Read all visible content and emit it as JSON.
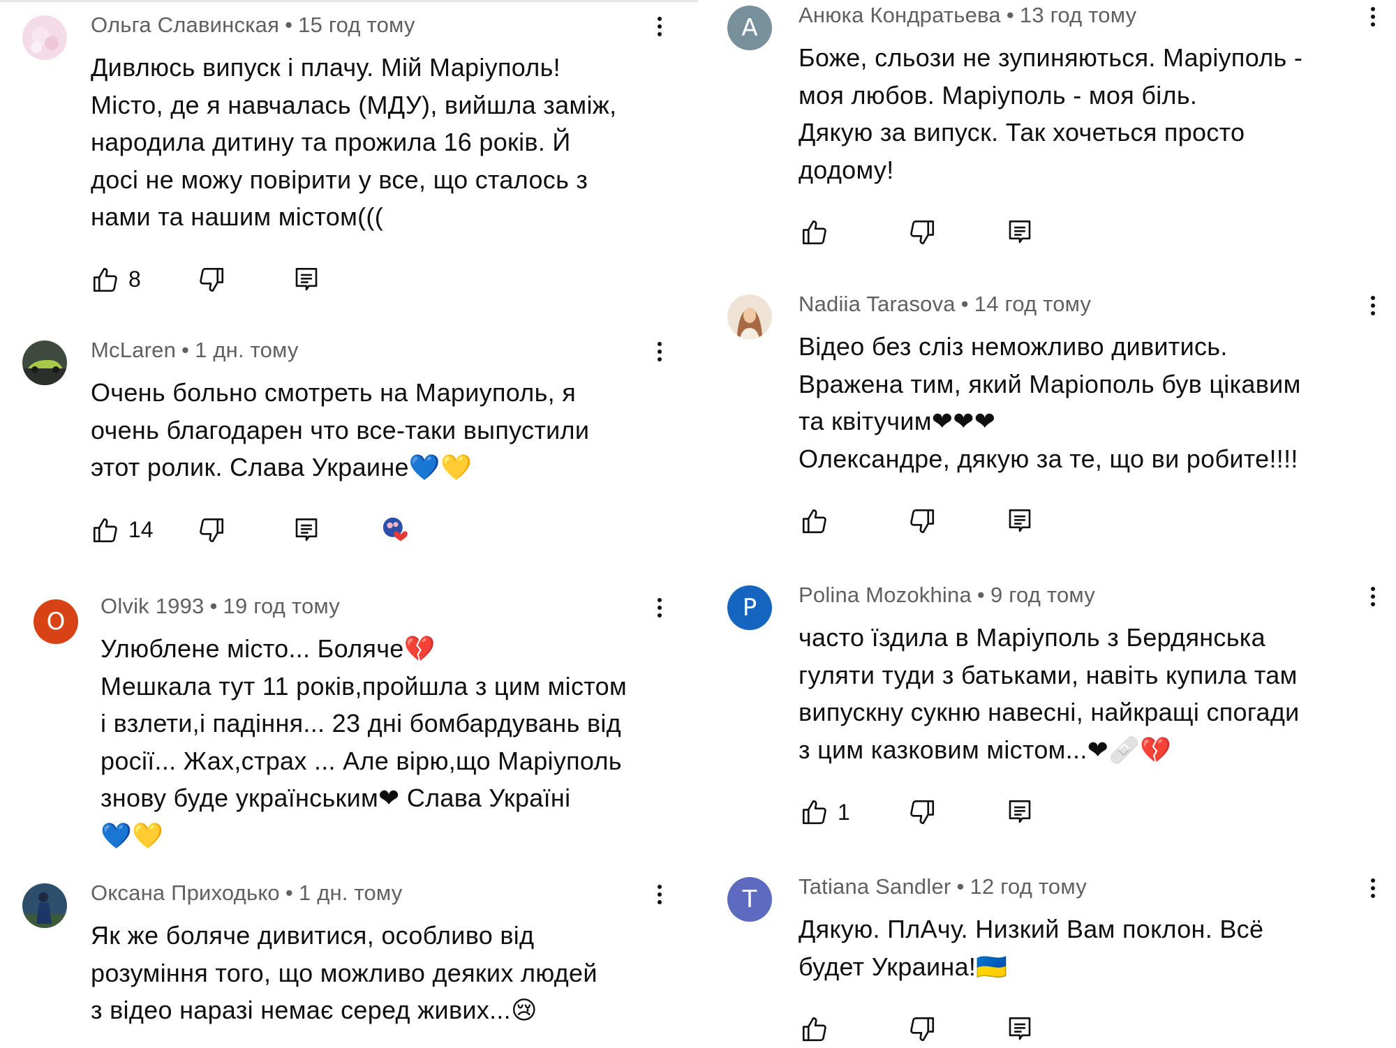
{
  "left": [
    {
      "author": "Ольга Славинская",
      "time": "15 год тому",
      "avatar": {
        "type": "image",
        "name": "flowers-photo"
      },
      "lines": [
        "Дивлюсь випуск і плачу. Мій Маріуполь!",
        "Місто, де я навчалась (МДУ), вийшла заміж,",
        "народила дитину та прожила 16 років. Й",
        "досі не можу повірити у все, що сталось з",
        "нами та нашим містом((("
      ],
      "likes": "8"
    },
    {
      "author": "McLaren",
      "time": "1 дн. тому",
      "avatar": {
        "type": "image",
        "name": "car-photo"
      },
      "lines": [
        "Очень больно смотреть на Мариуполь, я",
        "очень благодарен что все-таки выпустили",
        "этот ролик. Слава Украине💙💛"
      ],
      "likes": "14"
    },
    {
      "author": "Olvik 1993",
      "time": "19 год тому",
      "avatar": {
        "type": "letter",
        "letter": "O",
        "color": "#d84315"
      },
      "lines": [
        "Улюблене місто... Боляче💔",
        "Мешкала тут 11 років,пройшла з цим містом",
        "і взлети,і падіння... 23 дні бомбардувань від",
        "росії... Жах,страх ... Але вірю,що Маріуполь",
        "знову буде українським❤ Слава Україні",
        "💙💛"
      ]
    },
    {
      "author": "Оксана Приходько",
      "time": "1 дн. тому",
      "avatar": {
        "type": "image",
        "name": "person-photo"
      },
      "lines": [
        "Як же боляче дивитися, особливо від",
        "розуміння того, що можливо деяких людей",
        "з відео наразі немає серед живих...😢"
      ]
    }
  ],
  "right": [
    {
      "author": "Анюка Кондратьева",
      "time": "13 год тому",
      "avatar": {
        "type": "letter",
        "letter": "A",
        "color": "#78909c"
      },
      "lines": [
        "Боже, сльози не зупиняються. Маріуполь -",
        "моя любов.  Маріуполь  - моя біль.",
        "Дякую за випуск. Так хочеться просто",
        "додому!"
      ],
      "likes": ""
    },
    {
      "author": "Nadiia Tarasova",
      "time": "14 год тому",
      "avatar": {
        "type": "image",
        "name": "woman-photo"
      },
      "lines": [
        "Відео без сліз неможливо дивитись.",
        "Вражена тим, який Маріополь був цікавим",
        "та квітучим❤❤❤",
        "Олександре, дякую за те, що ви робите!!!!"
      ],
      "likes": ""
    },
    {
      "author": "Polina Mozokhina",
      "time": "9 год тому",
      "avatar": {
        "type": "letter",
        "letter": "P",
        "color": "#1565c0"
      },
      "lines": [
        "часто їздила в Маріуполь з Бердянська",
        "гуляти туди з батьками, навіть купила там",
        "випускну сукню навесні, найкращі спогади",
        "з цим казковим містом...❤🩹💔"
      ],
      "likes": "1"
    },
    {
      "author": "Tatiana Sandler",
      "time": "12 год тому",
      "avatar": {
        "type": "letter",
        "letter": "T",
        "color": "#5c6bc0"
      },
      "lines": [
        "Дякую. ПлАчу. Низкий Вам поклон. Всё",
        "будет Украина!🇺🇦"
      ],
      "likes": ""
    }
  ],
  "colors": {
    "meta": "#606060",
    "text": "#0f0f0f",
    "heart": "#e53935"
  }
}
